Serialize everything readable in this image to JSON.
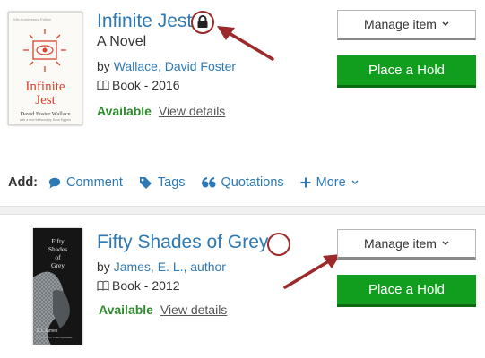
{
  "results": [
    {
      "title": "Infinite Jest",
      "subtitle": "A Novel",
      "author_prefix": "by",
      "author": "Wallace, David Foster",
      "format": "Book - 2016",
      "availability": "Available",
      "view_details": "View details",
      "manage_label": "Manage item",
      "hold_label": "Place a Hold",
      "cover": {
        "edition_line": "20th Anniversary Edition",
        "title_line1": "Infinite",
        "title_line2": "Jest",
        "author_line": "David Foster Wallace",
        "foreword_line": "with a new foreword by Dave Eggers"
      }
    },
    {
      "title": "Fifty Shades of Grey",
      "author_prefix": "by",
      "author": "James, E. L., author",
      "format": "Book - 2012",
      "availability": "Available",
      "view_details": "View details",
      "manage_label": "Manage item",
      "hold_label": "Place a Hold",
      "cover": {
        "title_line1": "Fifty",
        "title_line2": "Shades",
        "title_line3": "of",
        "title_line4": "Grey",
        "author_line": "E L James",
        "tagline": "#1 New York Times Bestseller"
      }
    }
  ],
  "add_bar": {
    "label": "Add:",
    "comment": "Comment",
    "tags": "Tags",
    "quotations": "Quotations",
    "more": "More"
  },
  "colors": {
    "link": "#2d79b6",
    "available": "#2e8b2e",
    "hold_button": "#119e1e",
    "annotation": "#9c2a2a"
  }
}
